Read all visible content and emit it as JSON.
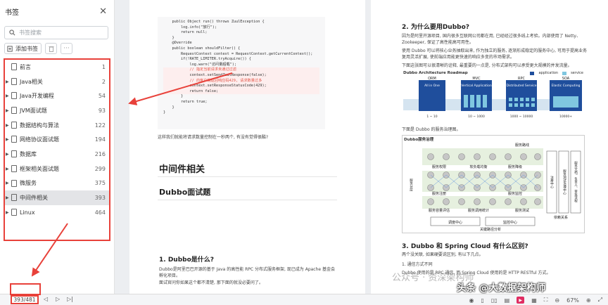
{
  "sidebar": {
    "title": "书签",
    "search_placeholder": "书签搜索",
    "add_label": "添加书签",
    "items": [
      {
        "label": "前言",
        "page": "1",
        "arrow": ""
      },
      {
        "label": "Java相关",
        "page": "2",
        "arrow": "▶"
      },
      {
        "label": "Java开发编程",
        "page": "54",
        "arrow": "▶"
      },
      {
        "label": "JVM面试题",
        "page": "93",
        "arrow": "▶"
      },
      {
        "label": "数据结构与算法",
        "page": "122",
        "arrow": "▶"
      },
      {
        "label": "网络协议面试题",
        "page": "194",
        "arrow": "▶"
      },
      {
        "label": "数据库",
        "page": "216",
        "arrow": "▶"
      },
      {
        "label": "框架相关面试题",
        "page": "299",
        "arrow": "▶"
      },
      {
        "label": "微服务",
        "page": "375",
        "arrow": "▶"
      },
      {
        "label": "中间件相关",
        "page": "393",
        "arrow": "▶"
      },
      {
        "label": "Linux",
        "page": "464",
        "arrow": "▶"
      }
    ]
  },
  "bottombar": {
    "page_indicator": "393/481",
    "zoom": "67%"
  },
  "left_page": {
    "code_lines": [
      "    public Object run() throws ZuulException {",
      "        log.info(\"放行\");",
      "        return null;",
      "    }",
      "",
      "    @Override",
      "    public boolean shouldFilter() {",
      "        RequestContext context = RequestContext.getCurrentContext();",
      "        if(!RATE_LIMITER.tryAcquire()) {",
      "            log.warn(\"访问量超载\");",
      "            // 指定当前请求未通过过滤",
      "            context.setSendZuulResponse(false);",
      "            // 向客户端返回响应码429, 请求数量过多",
      "            context.setResponseStatusCode(429);",
      "            return false;",
      "        }",
      "        return true;",
      "    }",
      "}"
    ],
    "code_caption": "这样我们就能将请求数量控制在一秒两个, 有没有觉得很酷?",
    "heading_middleware": "中间件相关",
    "heading_dubbo": "Dubbo面试题",
    "q1_title": "1. Dubbo是什么?",
    "q1_text1": "Dubbo是阿里巴巴开源的基于 Java 的高性能 RPC 分布式服务框架, 现已成为 Apache 基金会孵化项目。",
    "q1_text2": "面试官问你如果这个都不清楚, 那下面的就没必要问了。"
  },
  "right_page": {
    "q2_title": "2. 为什么要用Dubbo?",
    "q2_text1": "因为是阿里开源项目, 国内很多互联网公司都在用, 已经经过很多线上考验。内部使用了 Netty、Zookeeper, 保证了高性能高可用性。",
    "q2_text2": "使用 Dubbo 可以将核心业务抽取出来, 作为独立的服务, 逐渐形成稳定的服务中心, 可用于提高业务复用灵活扩展, 使前端应用能更快速的响应多变的市场需求。",
    "q2_text3": "下面这张图可以很清晰的诠释, 最重要的一点是, 分布式架构可以承受更大规模的并发流量。",
    "roadmap_title": "Dubbo Architecture Roadmap",
    "roadmap_legend": [
      "application",
      "service"
    ],
    "roadmap_stages": [
      "ORM",
      "MVC",
      "RPC",
      "SOA"
    ],
    "roadmap_boxes": [
      "All in One",
      "Vertical Application",
      "Distributed Service",
      "Elastic Computing"
    ],
    "roadmap_scale": [
      "1 ~ 10",
      "10 ~ 1000",
      "1000 ~ 10000",
      "10000+"
    ],
    "fig2_caption": "下面是 Dubbo 的服务治理图。",
    "gov_title": "Dubbo服务治理",
    "gov_labels": [
      "服务路线",
      "服务权限",
      "软负载均衡",
      "服务降级",
      "服务注册",
      "服务监控",
      "服务容量评估",
      "服务调用统计",
      "服务测试",
      "调度中心",
      "监控中心",
      "依赖关系",
      "关键路径分析",
      "服务分层",
      "服务文档、负责人、审批流程",
      "服务测试治理中心",
      "注册中心"
    ],
    "q3_title": "3. Dubbo 和 Spring Cloud 有什么区别?",
    "q3_text1": "两个没关联, 如果硬要说区别, 有以下几点。",
    "q3_text2": "1. 通信方式不同",
    "q3_text3": "Dubbo 使用的是 RPC 通信, 而 Spring Cloud 使用的是 HTTP RESTful 方式。",
    "watermark": "公众号 · 资深架构师",
    "toutiao": "头条 @大数据架构师"
  },
  "colors": {
    "highlight_red": "#e8413a",
    "roadmap_blue": "#1f4e9c"
  }
}
